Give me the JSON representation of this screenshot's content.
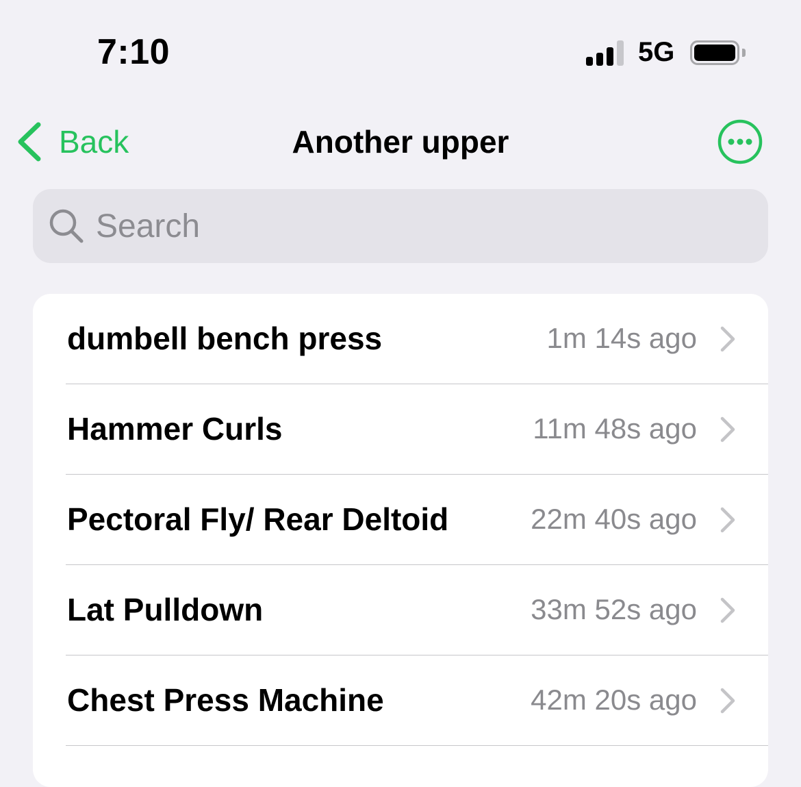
{
  "status_bar": {
    "time": "7:10",
    "network": "5G"
  },
  "nav": {
    "back_label": "Back",
    "title": "Another upper"
  },
  "search": {
    "placeholder": "Search",
    "value": ""
  },
  "colors": {
    "accent": "#27c25d",
    "background": "#f2f1f6",
    "secondary_text": "#8a8a8e"
  },
  "exercises": [
    {
      "name": "dumbell bench press",
      "time": "1m 14s ago"
    },
    {
      "name": "Hammer Curls",
      "time": "11m 48s ago"
    },
    {
      "name": "Pectoral Fly/ Rear Deltoid",
      "time": "22m 40s ago"
    },
    {
      "name": "Lat Pulldown",
      "time": "33m 52s ago"
    },
    {
      "name": "Chest Press Machine",
      "time": "42m 20s ago"
    }
  ]
}
